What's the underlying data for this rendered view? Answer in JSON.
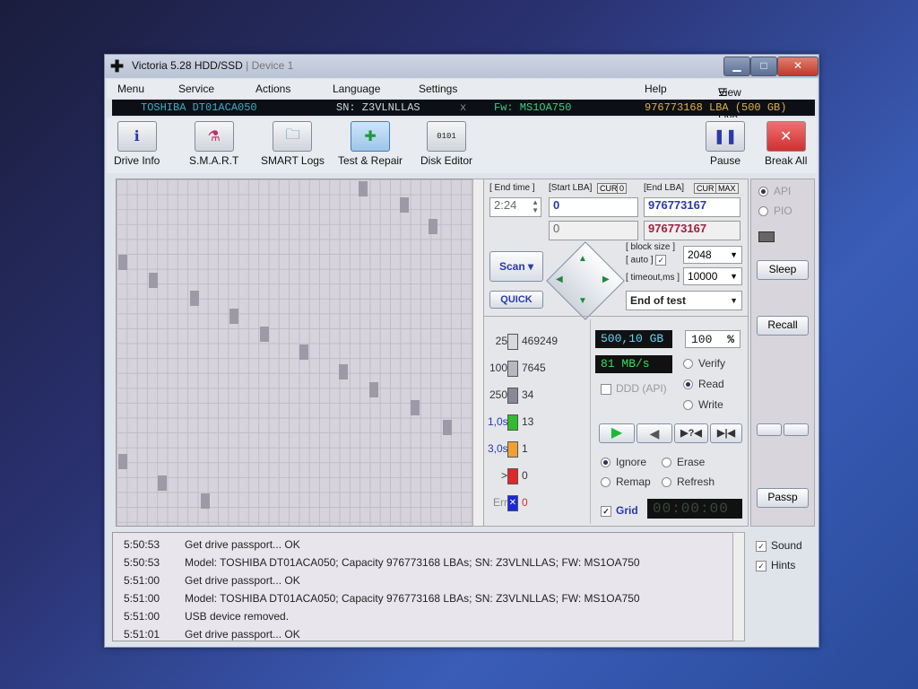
{
  "window": {
    "title": "Victoria 5.28 HDD/SSD",
    "title_sub": "| Device 1",
    "min": "▁",
    "max": "□",
    "close": "✕"
  },
  "menu": {
    "items": [
      "Menu",
      "Service",
      "Actions",
      "Language",
      "Settings",
      "Help"
    ],
    "buffer": "View Buffer Live"
  },
  "device": {
    "model": "TOSHIBA DT01ACA050",
    "sn": "SN: Z3VLNLLAS",
    "x": "x",
    "fw": "Fw: MS1OA750",
    "lba": "976773168 LBA (500 GB)"
  },
  "toolbar": {
    "drive_info": "Drive Info",
    "smart": "S.M.A.R.T",
    "smart_logs": "SMART Logs",
    "test_repair": "Test & Repair",
    "disk_editor": "Disk Editor",
    "pause": "Pause",
    "break_all": "Break All"
  },
  "scan": {
    "end_time_label": "[ End time ]",
    "end_time": "2:24",
    "start_lba_label": "[Start LBA]",
    "cur": "CUR",
    "zero_tag": "0",
    "end_lba_label": "[End LBA]",
    "max": "MAX",
    "start_lba": "0",
    "start_lba2": "0",
    "end_lba": "976773167",
    "end_lba2": "976773167",
    "scan_btn": "Scan",
    "quick_btn": "QUICK",
    "block_size_label": "[ block size ]",
    "auto_label": "[ auto ]",
    "block_size": "2048",
    "timeout_label": "[ timeout,ms ]",
    "timeout": "10000",
    "end_action": "End of test"
  },
  "stats": [
    {
      "label": "25",
      "value": "469249",
      "color": "#d8d8de"
    },
    {
      "label": "100",
      "value": "7645",
      "color": "#b8b6c2"
    },
    {
      "label": "250",
      "value": "34",
      "color": "#8a8898"
    },
    {
      "label": "1,0s",
      "value": "13",
      "color": "#2ebd2e"
    },
    {
      "label": "3,0s",
      "value": "1",
      "color": "#f0a030"
    },
    {
      "label": ">",
      "value": "0",
      "color": "#e02828"
    },
    {
      "label": "Err",
      "value": "0",
      "color": "#1a2ad8"
    }
  ],
  "readout": {
    "size": "500,10 GB",
    "percent": "100",
    "pct_sign": "%",
    "speed": "81 MB/s",
    "timer": "00:00:00"
  },
  "modes": {
    "verify": "Verify",
    "read": "Read",
    "write": "Write",
    "ddd": "DDD (API)"
  },
  "actions": {
    "ignore": "Ignore",
    "erase": "Erase",
    "remap": "Remap",
    "refresh": "Refresh",
    "grid": "Grid"
  },
  "side": {
    "api": "API",
    "pio": "PIO",
    "sleep": "Sleep",
    "recall": "Recall",
    "passp": "Passp"
  },
  "log": [
    {
      "time": "5:50:53",
      "msg": "Get drive passport... OK"
    },
    {
      "time": "5:50:53",
      "msg": "Model: TOSHIBA DT01ACA050; Capacity 976773168 LBAs; SN: Z3VLNLLAS; FW: MS1OA750"
    },
    {
      "time": "5:51:00",
      "msg": "Get drive passport... OK"
    },
    {
      "time": "5:51:00",
      "msg": "Model: TOSHIBA DT01ACA050; Capacity 976773168 LBAs; SN: Z3VLNLLAS; FW: MS1OA750"
    },
    {
      "time": "5:51:00",
      "msg": "USB device removed."
    },
    {
      "time": "5:51:01",
      "msg": "Get drive passport... OK"
    }
  ],
  "options": {
    "sound": "Sound",
    "hints": "Hints"
  },
  "colors": {
    "accent": "#2a3aa8",
    "lcd_text": "#5ed9ff",
    "lcd_green": "#36e05a",
    "dev_model": "#39b0c6",
    "dev_fw": "#3ad07a",
    "dev_lba": "#e0b040"
  }
}
